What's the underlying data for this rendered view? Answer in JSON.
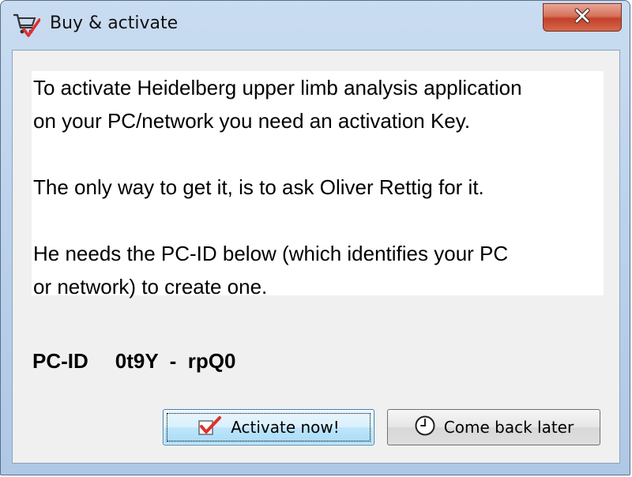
{
  "window": {
    "title": "Buy & activate",
    "icon": "cart-check-icon",
    "close_icon": "close-icon"
  },
  "message": {
    "line1": "To activate Heidelberg upper limb analysis application",
    "line2": "on your PC/network you need an activation Key.",
    "line3": "The only way to get it, is to ask Oliver Rettig for it.",
    "line4": "He needs the PC-ID below (which identifies your PC",
    "line5": "or network) to create one."
  },
  "pcid": {
    "label": "PC-ID",
    "value": "0t9Y  -  rpQ0"
  },
  "buttons": {
    "activate_label": "Activate now!",
    "activate_icon": "checkmark-icon",
    "later_label": "Come back later",
    "later_icon": "clock-icon"
  },
  "colors": {
    "close_button": "#c4402a",
    "activate_button": "#bee6fd",
    "checkmark": "#e03030"
  }
}
